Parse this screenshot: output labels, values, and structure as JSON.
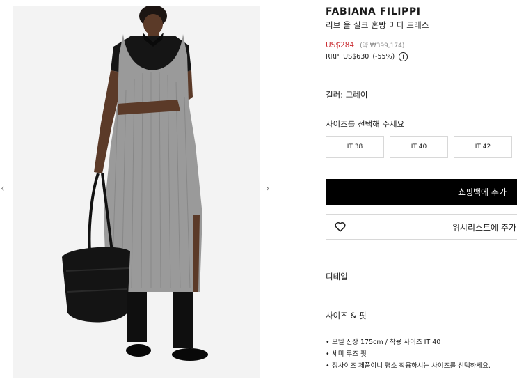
{
  "gallery": {
    "prev_icon": "chevron-left-icon",
    "next_icon": "chevron-right-icon"
  },
  "product": {
    "brand": "FABIANA FILIPPI",
    "name": "리브 울 실크 혼방 미디 드레스",
    "sale_price": "US$284",
    "krw_price": "(약 ₩399,174)",
    "rrp": "RRP: US$630",
    "discount": "(-55%)"
  },
  "color": {
    "label": "컬러: 그레이"
  },
  "sizes": {
    "prompt": "사이즈를 선택해 주세요",
    "options": [
      "IT 38",
      "IT 40",
      "IT 42"
    ]
  },
  "actions": {
    "add_to_bag": "쇼핑백에 추가",
    "wishlist": "위시리스트에 추가"
  },
  "sections": {
    "details": "디테일",
    "size_fit": "사이즈 & 핏"
  },
  "fit_notes": [
    "모델 신장 175cm / 착용 사이즈 IT 40",
    "세미 루즈 핏",
    "정사이즈 제품이니 평소 착용하시는 사이즈를 선택하세요."
  ],
  "colors": {
    "sale": "#c9282d",
    "primary_button": "#000000",
    "border": "#d8d8d8"
  }
}
